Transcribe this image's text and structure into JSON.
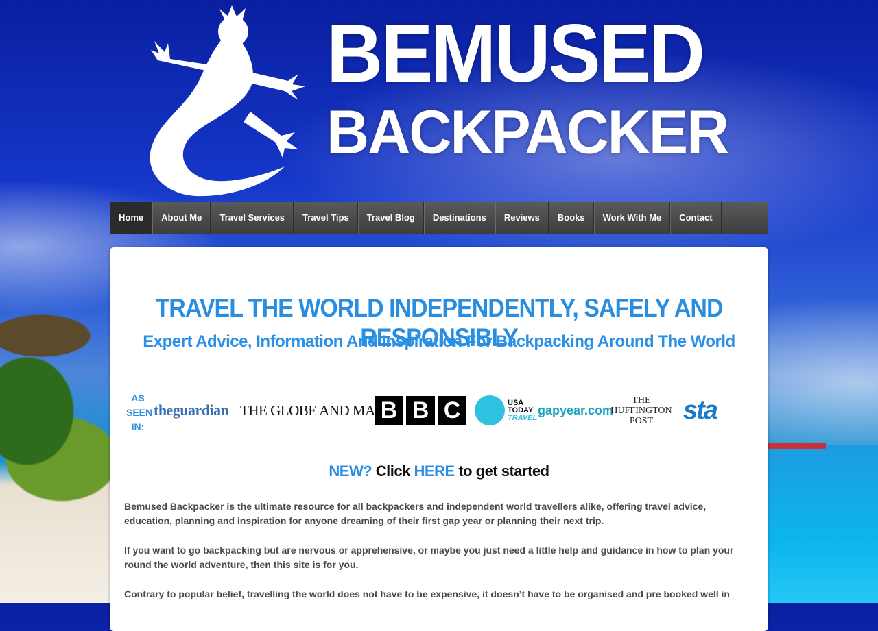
{
  "brand": {
    "line1": "BEMUSED",
    "line2": "BACKPACKER",
    "logo_icon": "gecko-icon"
  },
  "nav": {
    "items": [
      {
        "label": "Home",
        "active": true
      },
      {
        "label": "About Me"
      },
      {
        "label": "Travel Services"
      },
      {
        "label": "Travel Tips"
      },
      {
        "label": "Travel Blog"
      },
      {
        "label": "Destinations"
      },
      {
        "label": "Reviews"
      },
      {
        "label": "Books"
      },
      {
        "label": "Work With Me"
      },
      {
        "label": "Contact"
      }
    ]
  },
  "hero": {
    "headline": "TRAVEL THE WORLD INDEPENDENTLY, SAFELY AND RESPONSIBLY",
    "subheadline": "Expert Advice, Information And Inspiration For Backpacking Around The World"
  },
  "press": {
    "label_lines": [
      "AS",
      "SEEN",
      "IN:"
    ],
    "guardian": "theguardian",
    "globe": "THE GLOBE AND MAIL",
    "bbc": [
      "B",
      "B",
      "C"
    ],
    "usa_today": [
      "USA",
      "TODAY",
      "TRAVEL"
    ],
    "gapyear": "gapyear.com",
    "huffington": [
      "THE",
      "HUFFINGTON",
      "POST"
    ],
    "sta": "sta"
  },
  "cta": {
    "new": "NEW?",
    "click": "Click",
    "here": "HERE",
    "rest": "to get started"
  },
  "body": {
    "p1": "Bemused Backpacker is the ultimate resource for all backpackers and independent world travellers alike, offering travel advice, education, planning and inspiration for anyone dreaming of their first gap year or planning their next trip.",
    "p2": "If you want to go backpacking but are nervous or apprehensive, or maybe you just need a little help and guidance in how to plan your round the world adventure, then this site is for you.",
    "p3": "Contrary to popular belief, travelling the world does not have to be expensive, it doesn’t have to be organised and pre booked well in"
  },
  "colors": {
    "accent": "#2a8ee0",
    "nav_bg": "#4a4a4a",
    "text": "#4a4a4a"
  }
}
